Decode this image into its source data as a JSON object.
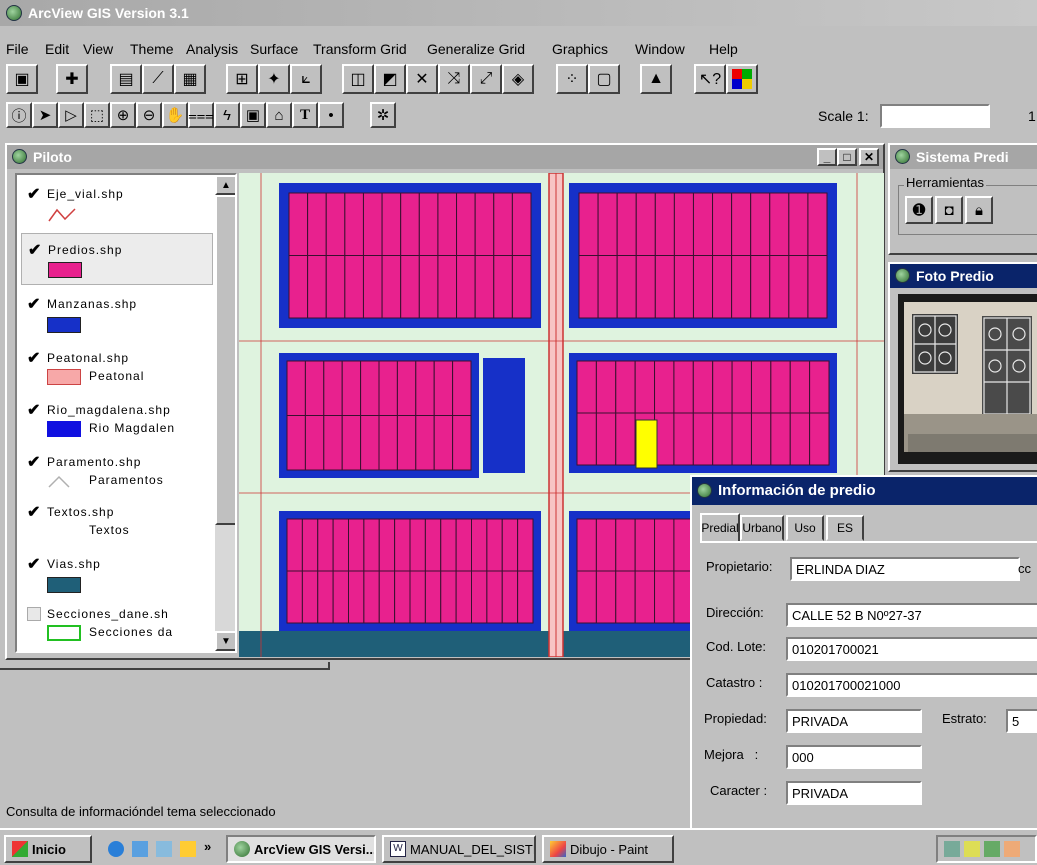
{
  "app": {
    "title": "ArcView GIS Version 3.1"
  },
  "menu": [
    "File",
    "Edit",
    "View",
    "Theme",
    "Analysis",
    "Surface",
    "Transform Grid",
    "Generalize Grid",
    "Graphics",
    "Window",
    "Help"
  ],
  "toolbar": {
    "scale_label": "Scale 1:",
    "scale_value": "",
    "extra": "1"
  },
  "view": {
    "title": "Piloto",
    "layers": [
      {
        "name": "Eje_vial.shp",
        "checked": true,
        "legend": ""
      },
      {
        "name": "Predios.shp",
        "checked": true,
        "legend": ""
      },
      {
        "name": "Manzanas.shp",
        "checked": true,
        "legend": ""
      },
      {
        "name": "Peatonal.shp",
        "checked": true,
        "legend": "Peatonal"
      },
      {
        "name": "Rio_magdalena.shp",
        "checked": true,
        "legend": "Rio Magdalen"
      },
      {
        "name": "Paramento.shp",
        "checked": true,
        "legend": "Paramentos"
      },
      {
        "name": "Textos.shp",
        "checked": true,
        "legend": "Textos"
      },
      {
        "name": "Vias.shp",
        "checked": true,
        "legend": ""
      },
      {
        "name": "Secciones_dane.sh",
        "checked": false,
        "legend": "Secciones da"
      }
    ],
    "colors": {
      "predios": "#e8218e",
      "manzanas": "#1630c8",
      "vias": "#1f5f78",
      "background": "#dff3df",
      "selected": "#ffff00",
      "peatonal": "#f7a8a8",
      "rio": "#1010e0"
    }
  },
  "sistema": {
    "title": "Sistema Predi",
    "group_label": "Herramientas"
  },
  "foto": {
    "title": "Foto Predio"
  },
  "info": {
    "title": "Información de predio",
    "tabs": [
      "Predial",
      "Urbano",
      "Uso",
      "ES"
    ],
    "propietario_label": "Propietario:",
    "propietario": "ERLINDA  DIAZ",
    "cc_label": "cc",
    "direccion_label": "Dirección:",
    "direccion": "CALLE 52 B N0º27-37",
    "cod_lote_label": "Cod. Lote:",
    "cod_lote": "010201700021",
    "catastro_label": "Catastro :",
    "catastro": "010201700021000",
    "propiedad_label": "Propiedad:",
    "propiedad": "PRIVADA",
    "estrato_label": "Estrato:",
    "estrato": "5",
    "mejora_label": "Mejora   :",
    "mejora": "000",
    "caracter_label": "Caracter :",
    "caracter": "PRIVADA"
  },
  "status": "Consulta de informacióndel tema seleccionado",
  "taskbar": {
    "start": "Inicio",
    "chevron": "»",
    "tasks": [
      "ArcView GIS Versi...",
      "MANUAL_DEL_SISTE...",
      "Dibujo - Paint"
    ]
  }
}
